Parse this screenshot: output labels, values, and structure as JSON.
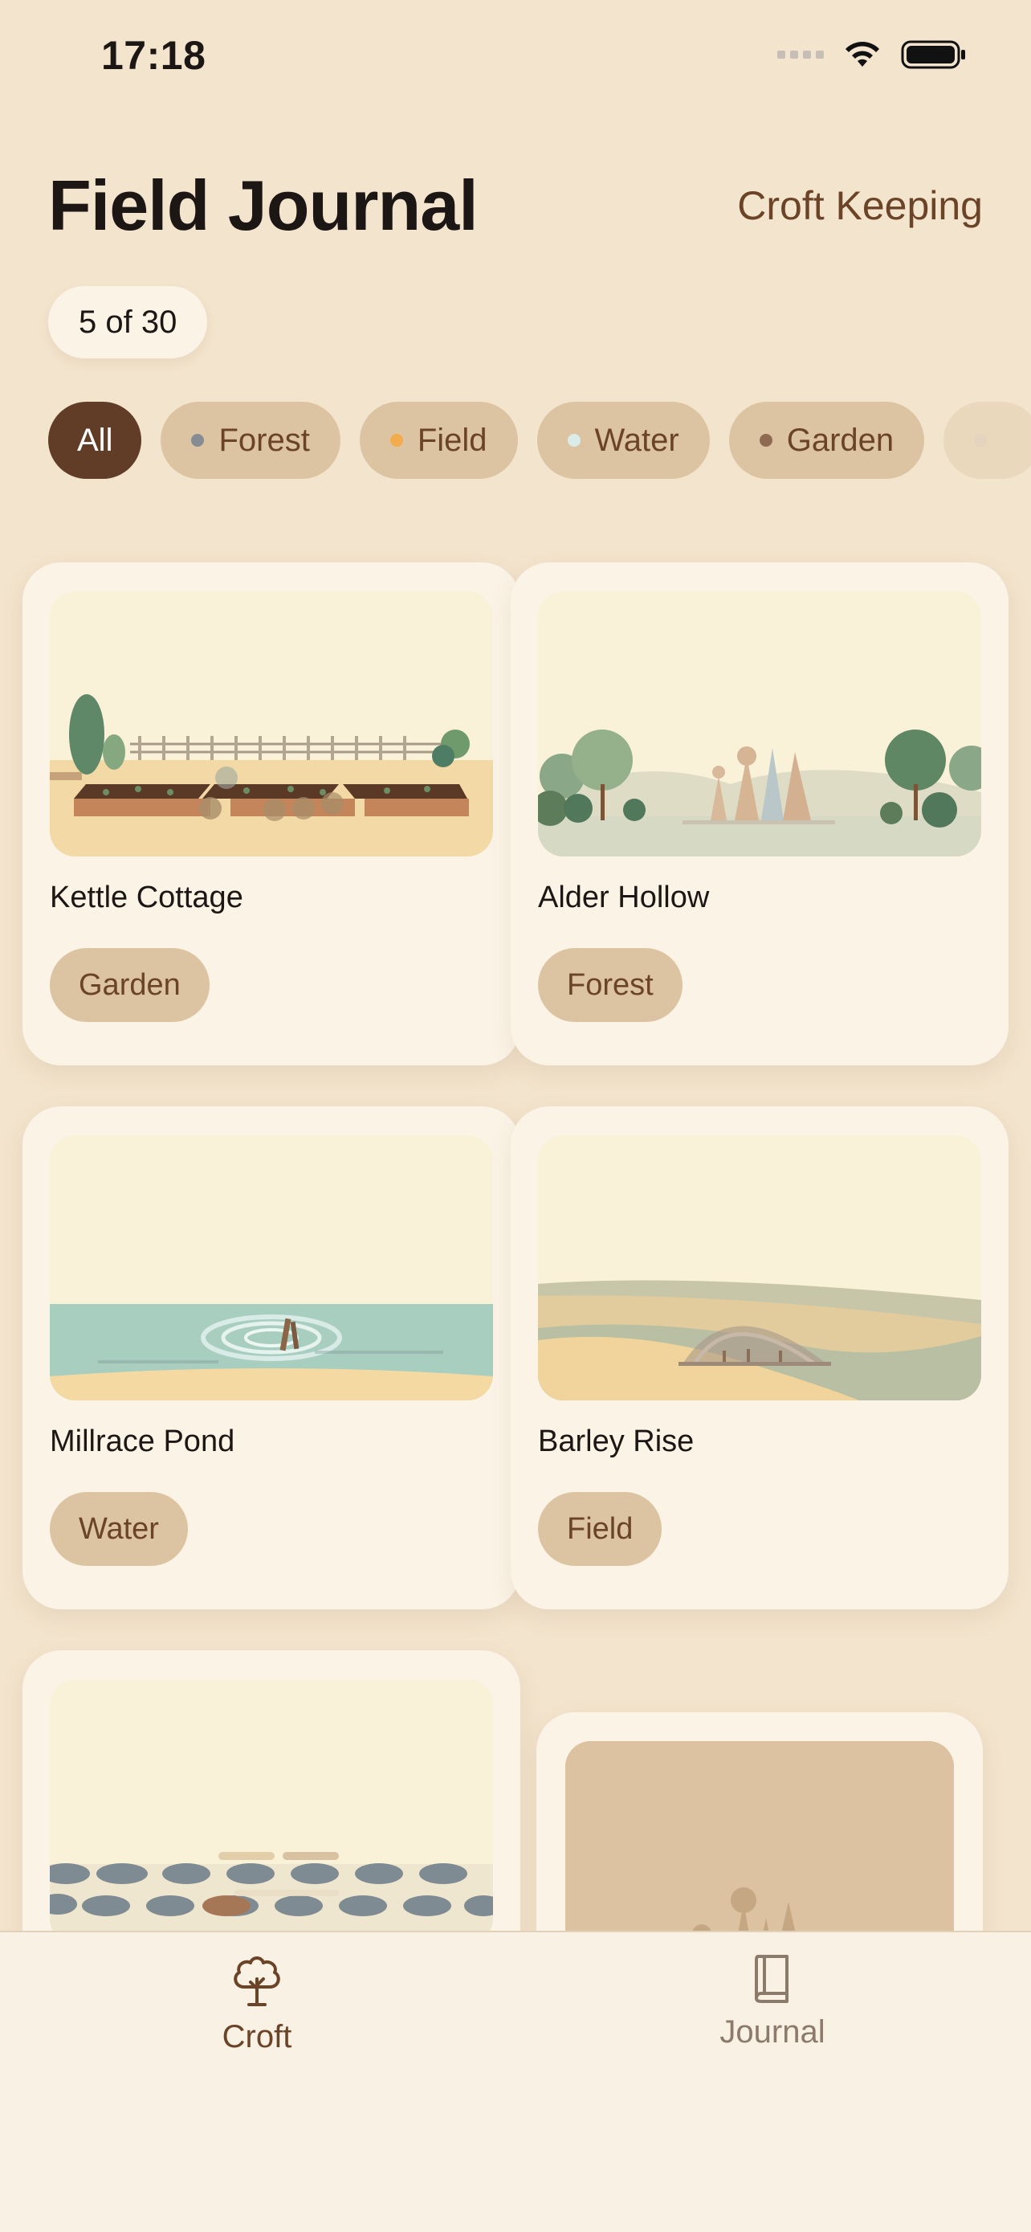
{
  "status_bar": {
    "time": "17:18"
  },
  "header": {
    "title": "Field Journal",
    "action_label": "Croft Keeping"
  },
  "count_label": "5 of 30",
  "filters": [
    {
      "label": "All",
      "active": true
    },
    {
      "label": "Forest",
      "dot_color": "#868c93"
    },
    {
      "label": "Field",
      "dot_color": "#f2ac4e"
    },
    {
      "label": "Water",
      "dot_color": "#d9ece9"
    },
    {
      "label": "Garden",
      "dot_color": "#8d6a51"
    }
  ],
  "entries": [
    {
      "title": "Kettle Cottage",
      "tag": "Garden"
    },
    {
      "title": "Alder Hollow",
      "tag": "Forest"
    },
    {
      "title": "Millrace Pond",
      "tag": "Water"
    },
    {
      "title": "Barley Rise",
      "tag": "Field"
    }
  ],
  "tab_bar": {
    "tabs": [
      {
        "label": "Croft",
        "icon": "tree-icon",
        "active": true
      },
      {
        "label": "Journal",
        "icon": "book-icon",
        "active": false
      }
    ]
  },
  "colors": {
    "background": "#f3e4cd",
    "card": "#fbf3e6",
    "accent_dark": "#613d27",
    "chip": "#dcc4a2",
    "chip_text": "#6b4428"
  }
}
